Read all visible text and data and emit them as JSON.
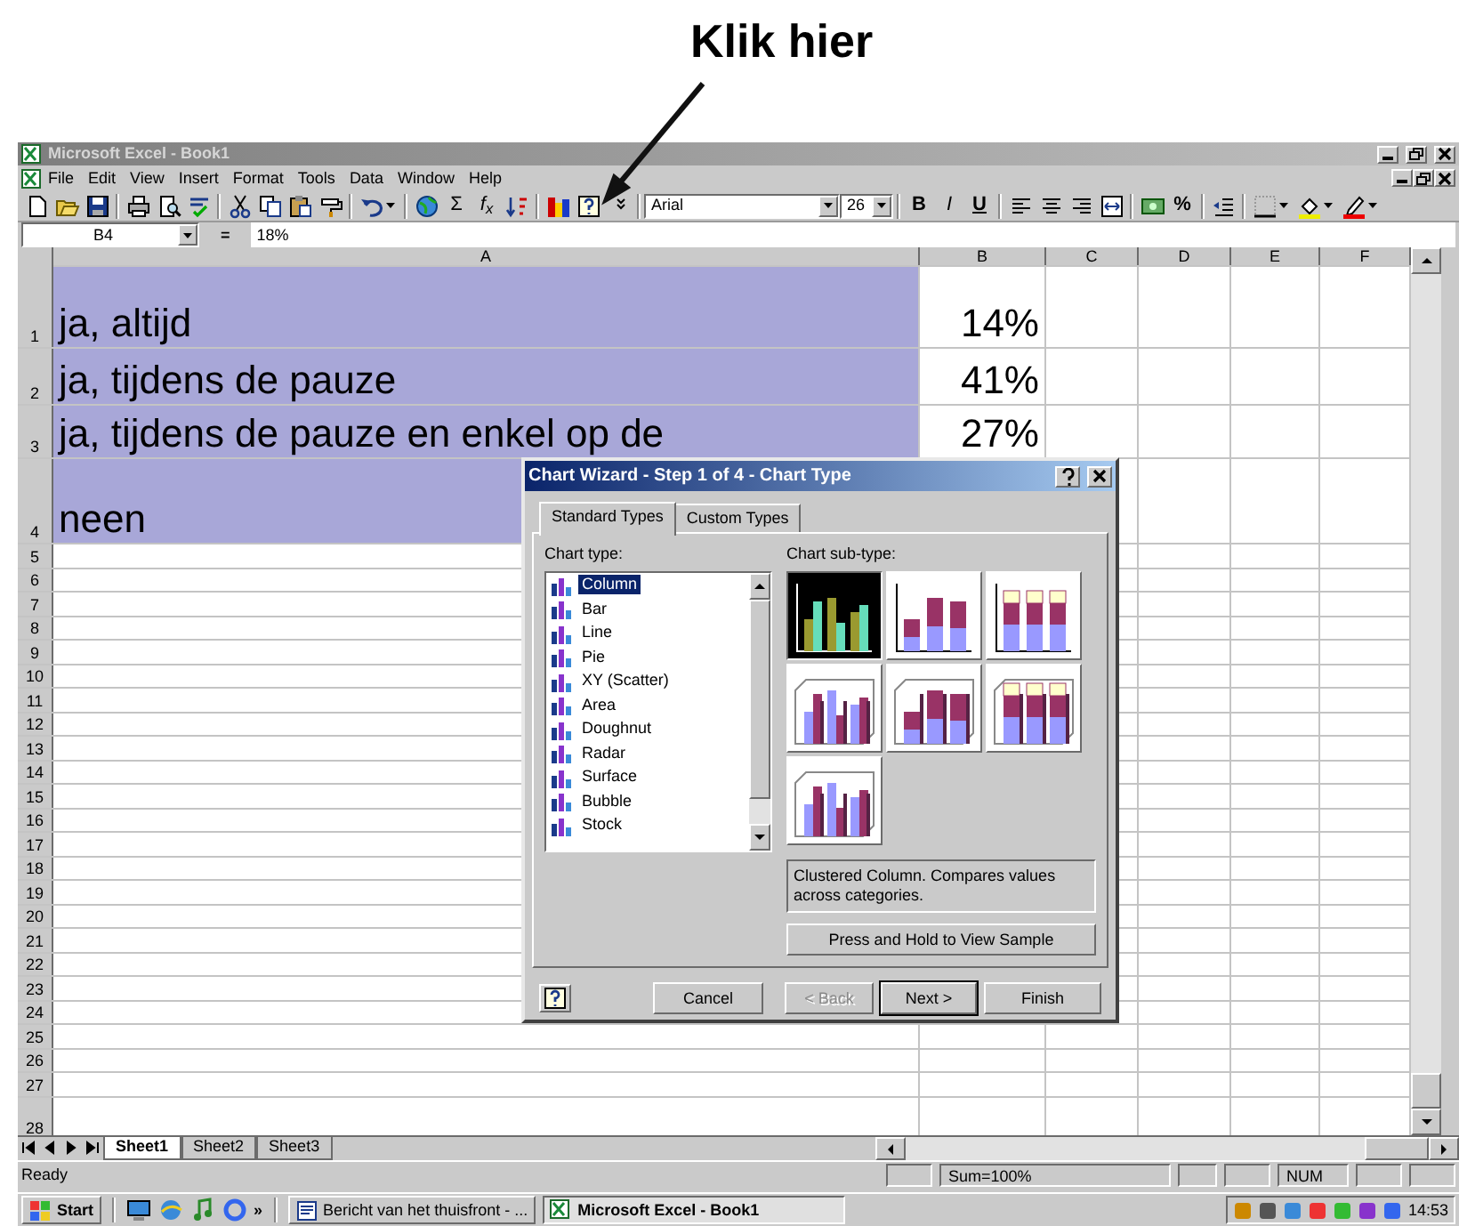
{
  "annotation": {
    "text": "Klik hier"
  },
  "window": {
    "title": "Microsoft Excel - Book1",
    "active": false
  },
  "menu": [
    "File",
    "Edit",
    "View",
    "Insert",
    "Format",
    "Tools",
    "Data",
    "Window",
    "Help"
  ],
  "toolbar": {
    "glyphs": [
      {
        "text": "Σ",
        "kind": "plain"
      },
      {
        "text": "f$_{x}$",
        "kind": "italic"
      },
      {
        "text": "B",
        "kind": "bold"
      },
      {
        "text": "I",
        "kind": "italic"
      },
      {
        "text": "U",
        "kind": "underline"
      },
      {
        "text": "%",
        "kind": "bold"
      }
    ],
    "font": "Arial",
    "size": "26"
  },
  "formula_bar": {
    "cell": "B4",
    "equals": "=",
    "value": "18%"
  },
  "columns": [
    "A",
    "B",
    "C",
    "D",
    "E",
    "F"
  ],
  "rows": [
    {
      "number": "1",
      "a": "ja, altijd",
      "b": "14%",
      "selected": true
    },
    {
      "number": "2",
      "a": "ja, tijdens de pauze",
      "b": "41%",
      "selected": true
    },
    {
      "number": "3",
      "a": "ja, tijdens de pauze en enkel op de",
      "b": "27%",
      "selected": true
    },
    {
      "number": "4",
      "a": "neen",
      "selected": true
    }
  ],
  "empty_rows": [
    "5",
    "6",
    "7",
    "8",
    "9",
    "10",
    "11",
    "12",
    "13",
    "14",
    "15",
    "16",
    "17",
    "18",
    "19",
    "20",
    "21",
    "22",
    "23",
    "24",
    "25",
    "26",
    "27",
    "28"
  ],
  "sheets": [
    {
      "label": "Sheet1",
      "selected": true
    },
    {
      "label": "Sheet2",
      "selected": false
    },
    {
      "label": "Sheet3",
      "selected": false
    }
  ],
  "status_bar": {
    "text": "Ready",
    "sum": "Sum=100%",
    "num": "NUM"
  },
  "dialog": {
    "title": "Chart Wizard - Step 1 of 4 - Chart Type",
    "tabs": [
      {
        "label": "Standard Types",
        "selected": true
      },
      {
        "label": "Custom Types",
        "selected": false
      }
    ],
    "chart_type_label": "Chart type:",
    "chart_types": [
      {
        "label": "Column",
        "selected": true
      },
      {
        "label": "Bar",
        "selected": false
      },
      {
        "label": "Line",
        "selected": false
      },
      {
        "label": "Pie",
        "selected": false
      },
      {
        "label": "XY (Scatter)",
        "selected": false
      },
      {
        "label": "Area",
        "selected": false
      },
      {
        "label": "Doughnut",
        "selected": false
      },
      {
        "label": "Radar",
        "selected": false
      },
      {
        "label": "Surface",
        "selected": false
      },
      {
        "label": "Bubble",
        "selected": false
      },
      {
        "label": "Stock",
        "selected": false
      }
    ],
    "subtype_label": "Chart sub-type:",
    "subtypes": [
      {
        "selected": true
      },
      {
        "selected": false
      },
      {
        "selected": false
      },
      {
        "selected": false
      },
      {
        "selected": false
      },
      {
        "selected": false
      },
      {
        "selected": false
      }
    ],
    "description": "Clustered Column. Compares values across categories.",
    "sample_button": "Press and Hold to View Sample",
    "buttons": [
      {
        "label": "Cancel",
        "disabled": false,
        "default": false
      },
      {
        "label": "< Back",
        "disabled": true,
        "default": false
      },
      {
        "label": "Next >",
        "disabled": false,
        "default": true
      },
      {
        "label": "Finish",
        "disabled": false,
        "default": false
      }
    ]
  },
  "taskbar": {
    "start": "Start",
    "more": "»",
    "tasks": [
      {
        "label": "Bericht van het thuisfront - ...",
        "selected": false
      },
      {
        "label": "Microsoft Excel - Book1",
        "selected": true
      }
    ],
    "clock": "14:53"
  }
}
